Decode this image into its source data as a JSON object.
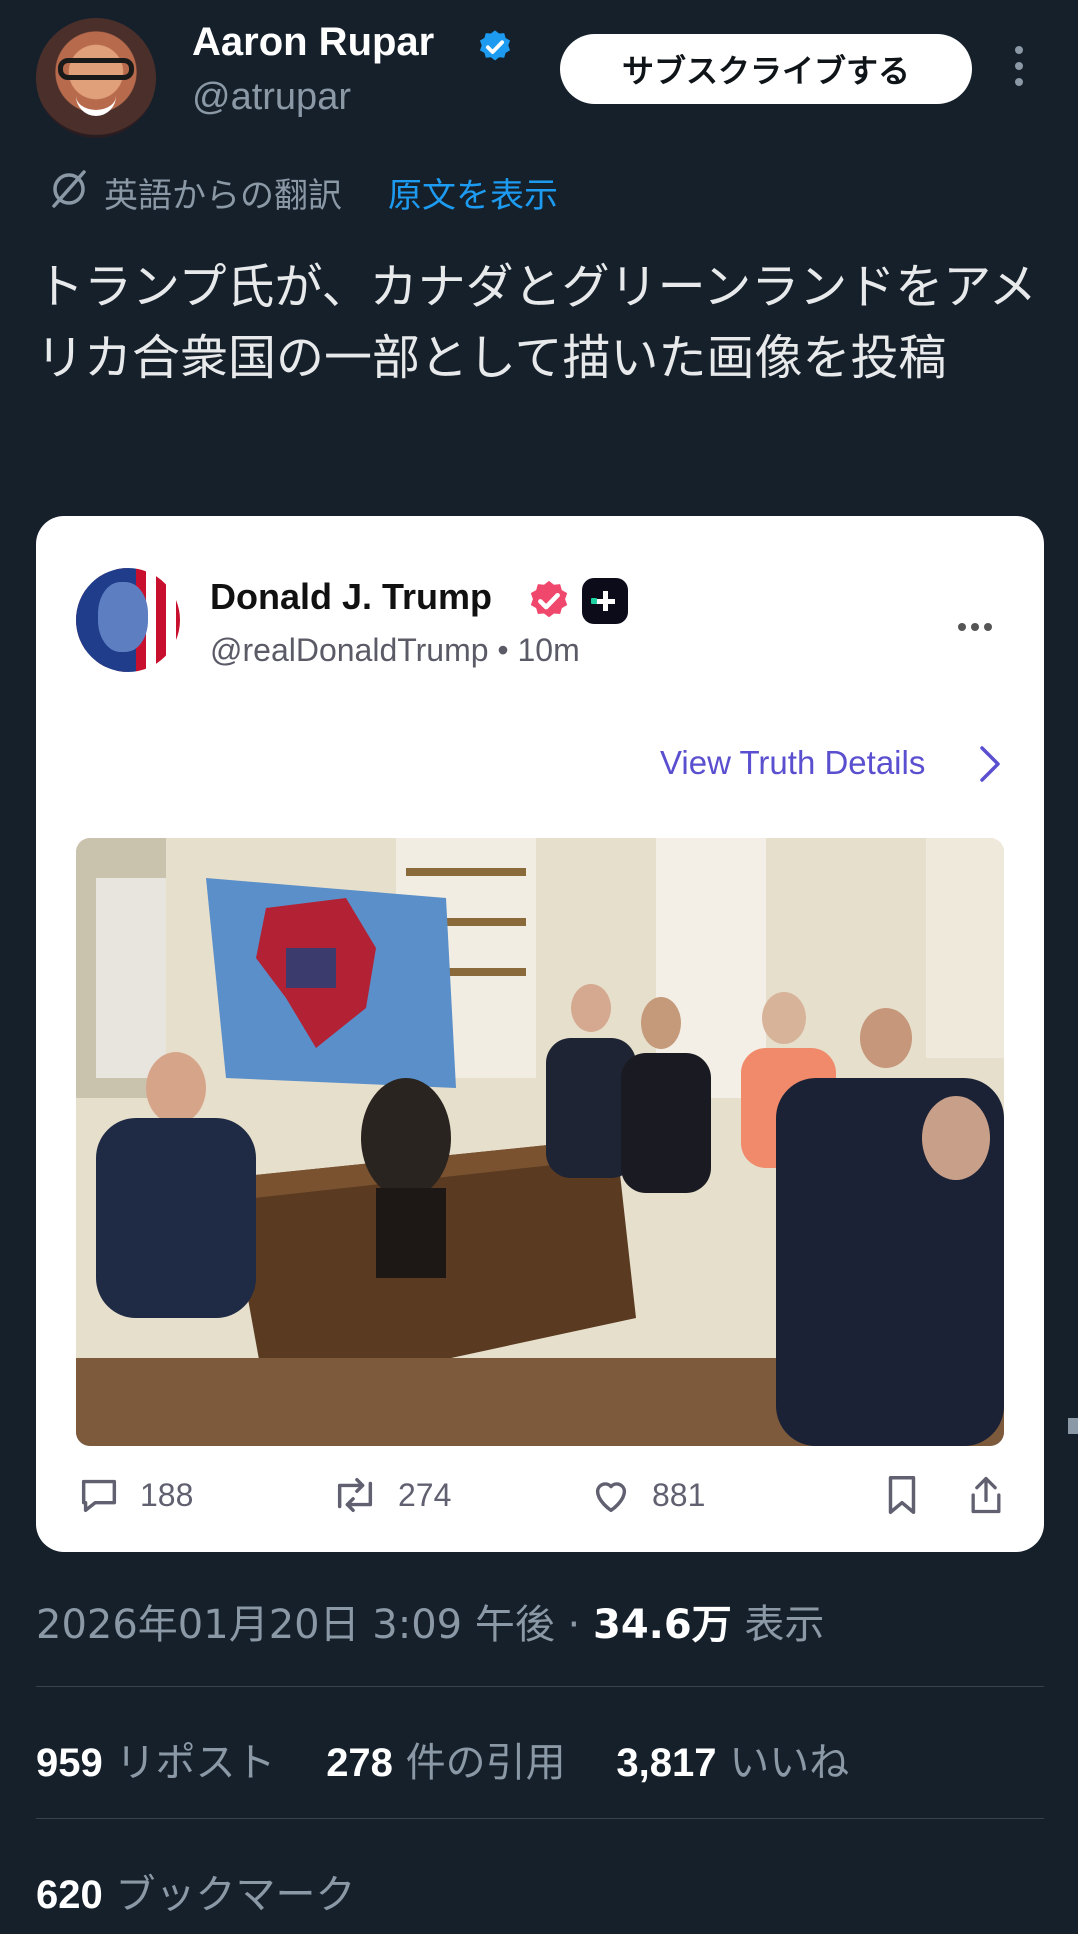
{
  "author": {
    "name": "Aaron Rupar",
    "handle": "@atrupar",
    "subscribe_label": "サブスクライブする"
  },
  "translation": {
    "label": "英語からの翻訳",
    "show_original": "原文を表示"
  },
  "tweet_text": "トランプ氏が、カナダとグリーンランドをアメリカ合衆国の一部として描いた画像を投稿",
  "embedded_post": {
    "name": "Donald J. Trump",
    "handle": "@realDonaldTrump • 10m",
    "view_details": "View Truth Details",
    "replies": "188",
    "reposts": "274",
    "likes": "881"
  },
  "timestamp": {
    "date": "2026年01月20日 3:09 午後 · ",
    "views_count": "34.6万",
    "views_label": " 表示"
  },
  "metrics": {
    "reposts_count": "959",
    "reposts_label": " リポスト",
    "quotes_count": "278",
    "quotes_label": " 件の引用",
    "likes_count": "3,817",
    "likes_label": " いいね",
    "bookmarks_count": "620",
    "bookmarks_label": " ブックマーク"
  },
  "colors": {
    "background": "#15202b",
    "link": "#1d9bf0",
    "verified": "#1d9bf0",
    "truth_accent": "#5a4fcf"
  }
}
